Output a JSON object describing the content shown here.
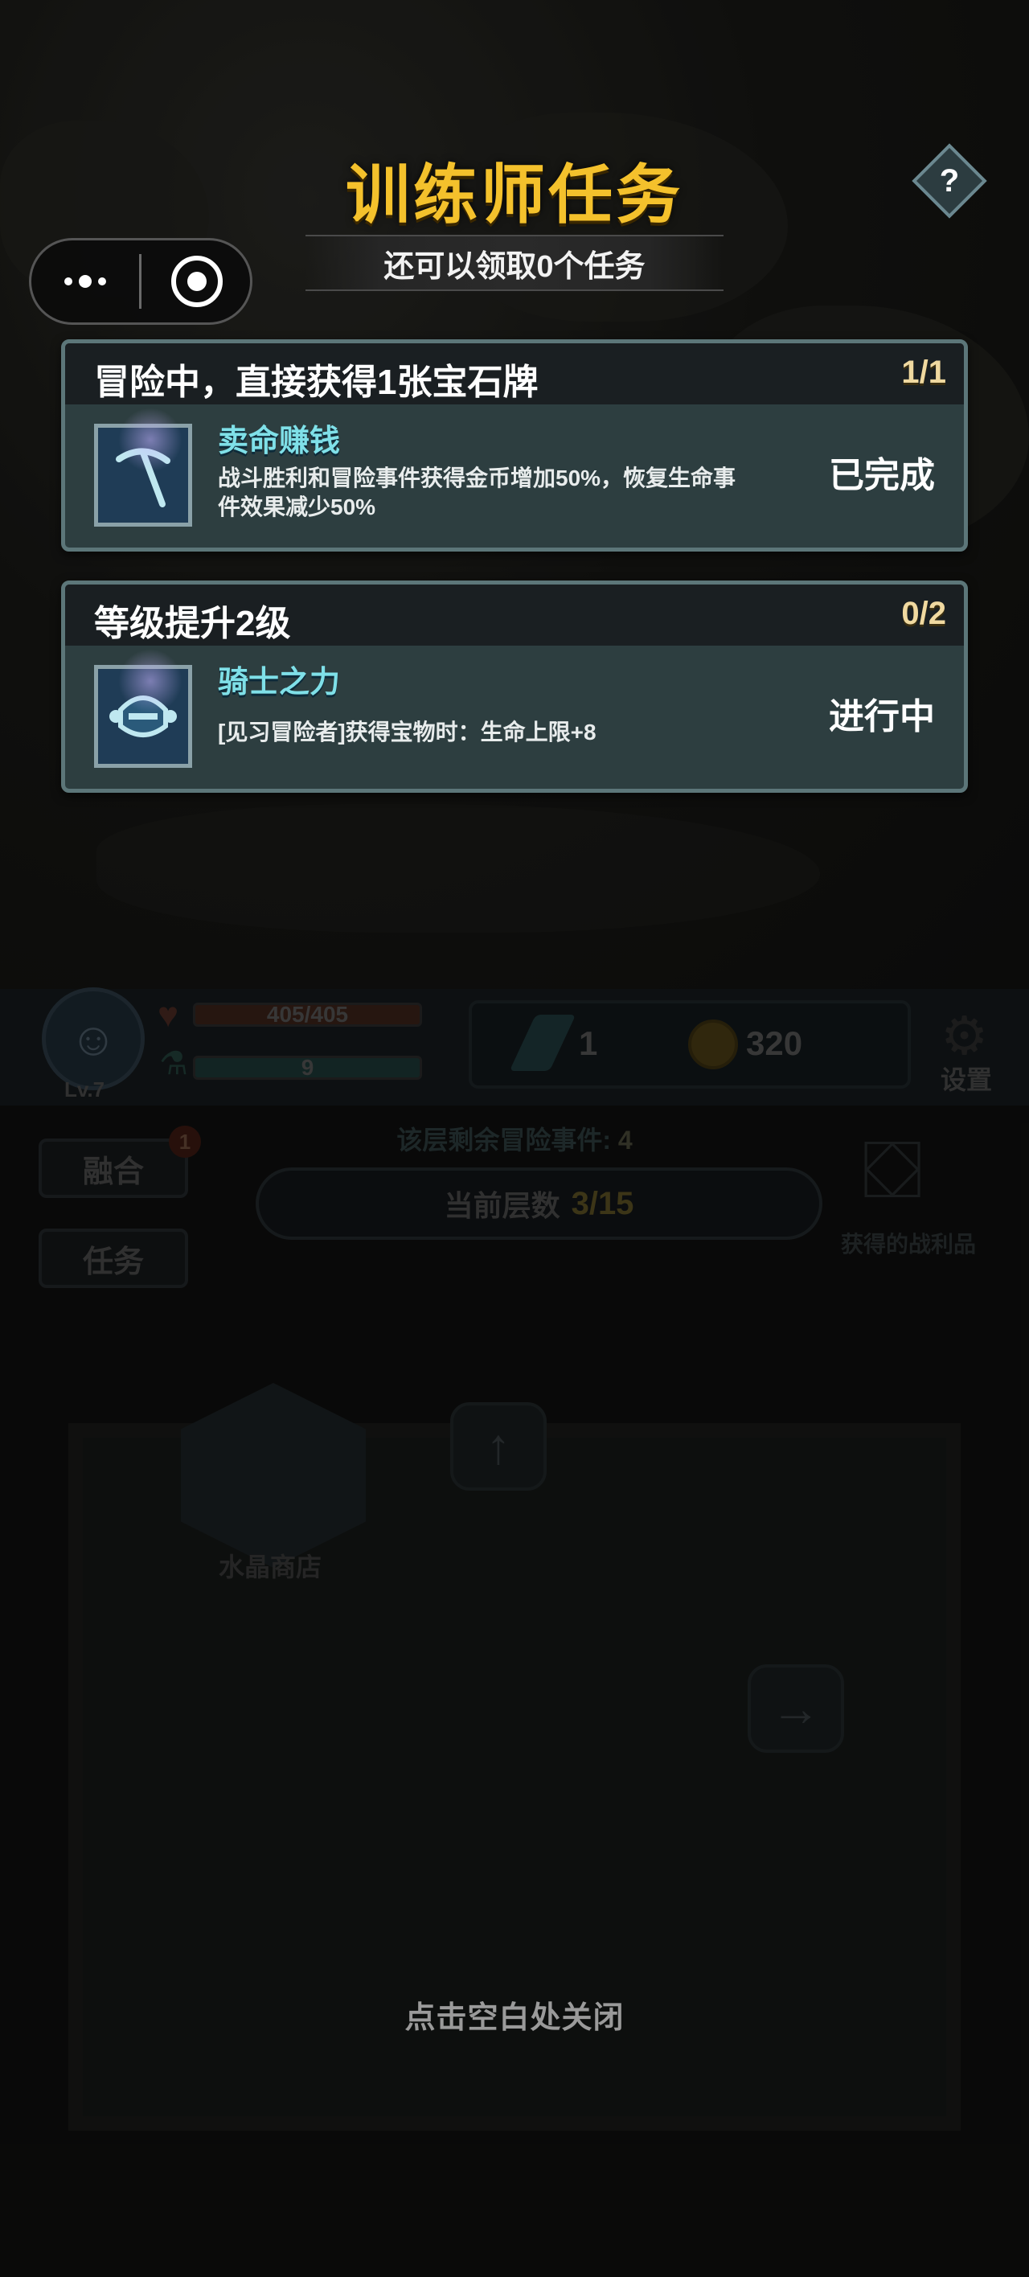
{
  "header": {
    "title": "训练师任务",
    "subtitle": "还可以领取0个任务",
    "help_label": "?"
  },
  "tasks": [
    {
      "title": "冒险中，直接获得1张宝石牌",
      "progress": "1/1",
      "skill_name": "卖命赚钱",
      "description": "战斗胜利和冒险事件获得金币增加50%，恢复生命事件效果减少50%",
      "status": "已完成",
      "icon": "pickaxe-icon"
    },
    {
      "title": "等级提升2级",
      "progress": "0/2",
      "skill_name": "骑士之力",
      "description": "[见习冒险者]获得宝物时：生命上限+8",
      "status": "进行中",
      "icon": "knight-helmet-icon"
    }
  ],
  "hud": {
    "level": "Lv.7",
    "hp": "405/405",
    "mp": "9",
    "crystals": "1",
    "gold": "320",
    "settings_label": "设置"
  },
  "side_buttons": {
    "fusion": "融合",
    "fusion_badge": "1",
    "tasks": "任务"
  },
  "floor": {
    "remaining_label": "该层剩余冒险事件:",
    "remaining_count": "4",
    "current_label": "当前层数",
    "current_value": "3/15",
    "loot_label": "获得的战利品"
  },
  "map": {
    "shop_label": "水晶商店"
  },
  "close_hint": "点击空白处关闭",
  "colors": {
    "title": "#f4c12c",
    "skill_name": "#7fe0e8",
    "card_bg": "#2d3e40",
    "card_head": "#1a1f22"
  }
}
